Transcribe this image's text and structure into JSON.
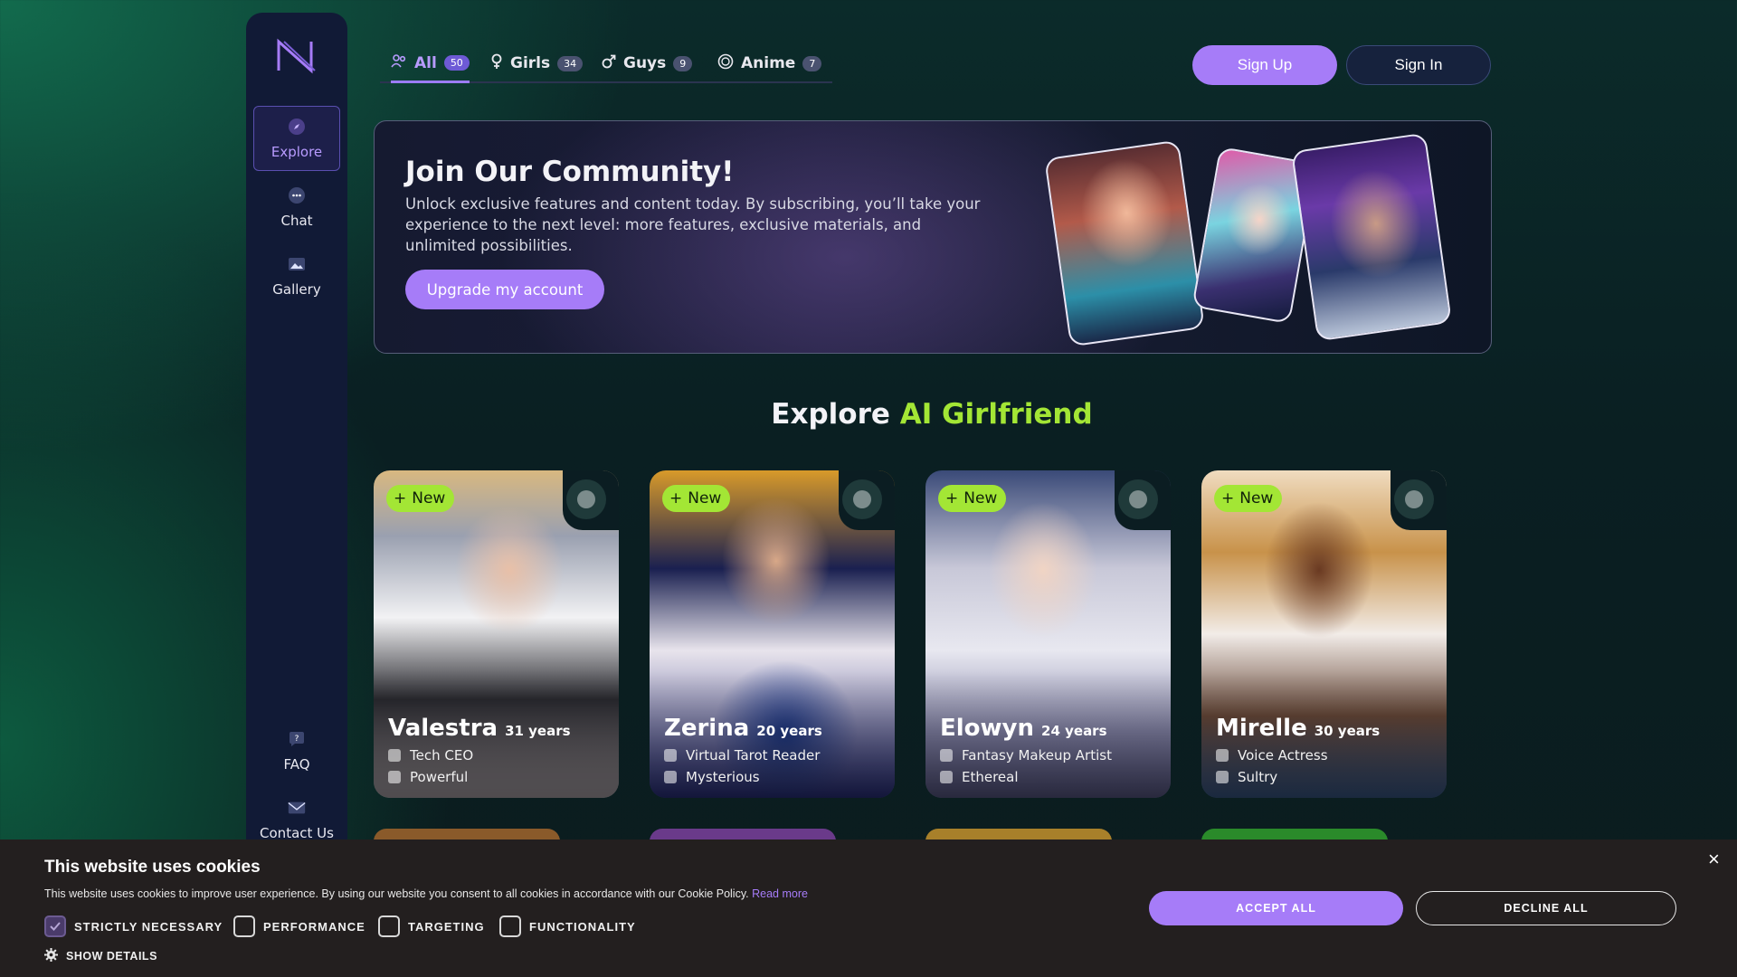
{
  "sidebar": {
    "logo_icon": "n-logo-icon",
    "items": [
      {
        "label": "Explore",
        "icon": "compass-icon",
        "active": true
      },
      {
        "label": "Chat",
        "icon": "chat-bubble-icon"
      },
      {
        "label": "Gallery",
        "icon": "image-icon"
      },
      {
        "label": "FAQ",
        "icon": "question-icon"
      },
      {
        "label": "Contact Us",
        "icon": "mail-icon"
      }
    ]
  },
  "tabs": [
    {
      "label": "All",
      "count": "50",
      "icon": "people-icon",
      "active": true
    },
    {
      "label": "Girls",
      "count": "34",
      "icon": "female-icon"
    },
    {
      "label": "Guys",
      "count": "9",
      "icon": "male-icon"
    },
    {
      "label": "Anime",
      "count": "7",
      "icon": "anime-icon"
    }
  ],
  "auth": {
    "sign_up": "Sign Up",
    "sign_in": "Sign In"
  },
  "banner": {
    "title": "Join Our Community!",
    "text": "Unlock exclusive features and content today. By subscribing, you’ll take your experience to the next level: more features, exclusive materials, and unlimited possibilities.",
    "cta": "Upgrade my account"
  },
  "section": {
    "title_prefix": "Explore",
    "title_accent": "AI Girlfriend"
  },
  "cards": [
    {
      "tag": "New",
      "name": "Valestra",
      "age": "31 years",
      "role": "Tech CEO",
      "trait": "Powerful"
    },
    {
      "tag": "New",
      "name": "Zerina",
      "age": "20 years",
      "role": "Virtual Tarot Reader",
      "trait": "Mysterious"
    },
    {
      "tag": "New",
      "name": "Elowyn",
      "age": "24 years",
      "role": "Fantasy Makeup Artist",
      "trait": "Ethereal"
    },
    {
      "tag": "New",
      "name": "Mirelle",
      "age": "30 years",
      "role": "Voice Actress",
      "trait": "Sultry"
    }
  ],
  "cookie": {
    "title": "This website uses cookies",
    "text": "This website uses cookies to improve user experience. By using our website you consent to all cookies in accordance with our Cookie Policy.",
    "read_more": "Read more",
    "options": [
      {
        "label": "STRICTLY NECESSARY",
        "checked": true
      },
      {
        "label": "PERFORMANCE",
        "checked": false
      },
      {
        "label": "TARGETING",
        "checked": false
      },
      {
        "label": "FUNCTIONALITY",
        "checked": false
      }
    ],
    "show_details": "SHOW DETAILS",
    "accept": "ACCEPT ALL",
    "decline": "DECLINE ALL",
    "close": "×"
  },
  "colors": {
    "accent": "#a67cf8",
    "green_accent": "#a3e635",
    "sidebar_bg": "#111a36"
  }
}
